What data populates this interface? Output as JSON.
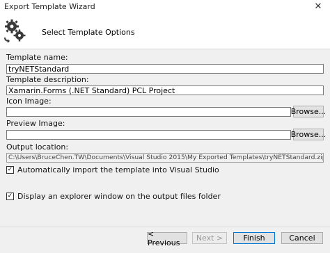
{
  "window": {
    "title": "Export Template Wizard",
    "close_glyph": "✕"
  },
  "header": {
    "heading": "Select Template Options",
    "icon": "gear-cycle-icon"
  },
  "form": {
    "template_name_label": "Template name:",
    "template_name_value": "tryNETStandard",
    "template_description_label": "Template description:",
    "template_description_value": "Xamarin.Forms (.NET Standard) PCL Project",
    "icon_image_label": "Icon Image:",
    "icon_image_value": "",
    "preview_image_label": "Preview Image:",
    "preview_image_value": "",
    "browse_label": "Browse...",
    "output_location_label": "Output location:",
    "output_location_value": "C:\\Users\\BruceChen.TW\\Documents\\Visual Studio 2015\\My Exported Templates\\tryNETStandard.zip",
    "auto_import_label": "Automatically import the template into Visual Studio",
    "auto_import_checked": true,
    "display_explorer_label": "Display an explorer window on the output files folder",
    "display_explorer_checked": true
  },
  "buttons": {
    "previous": "< Previous",
    "next": "Next >",
    "finish": "Finish",
    "cancel": "Cancel"
  }
}
